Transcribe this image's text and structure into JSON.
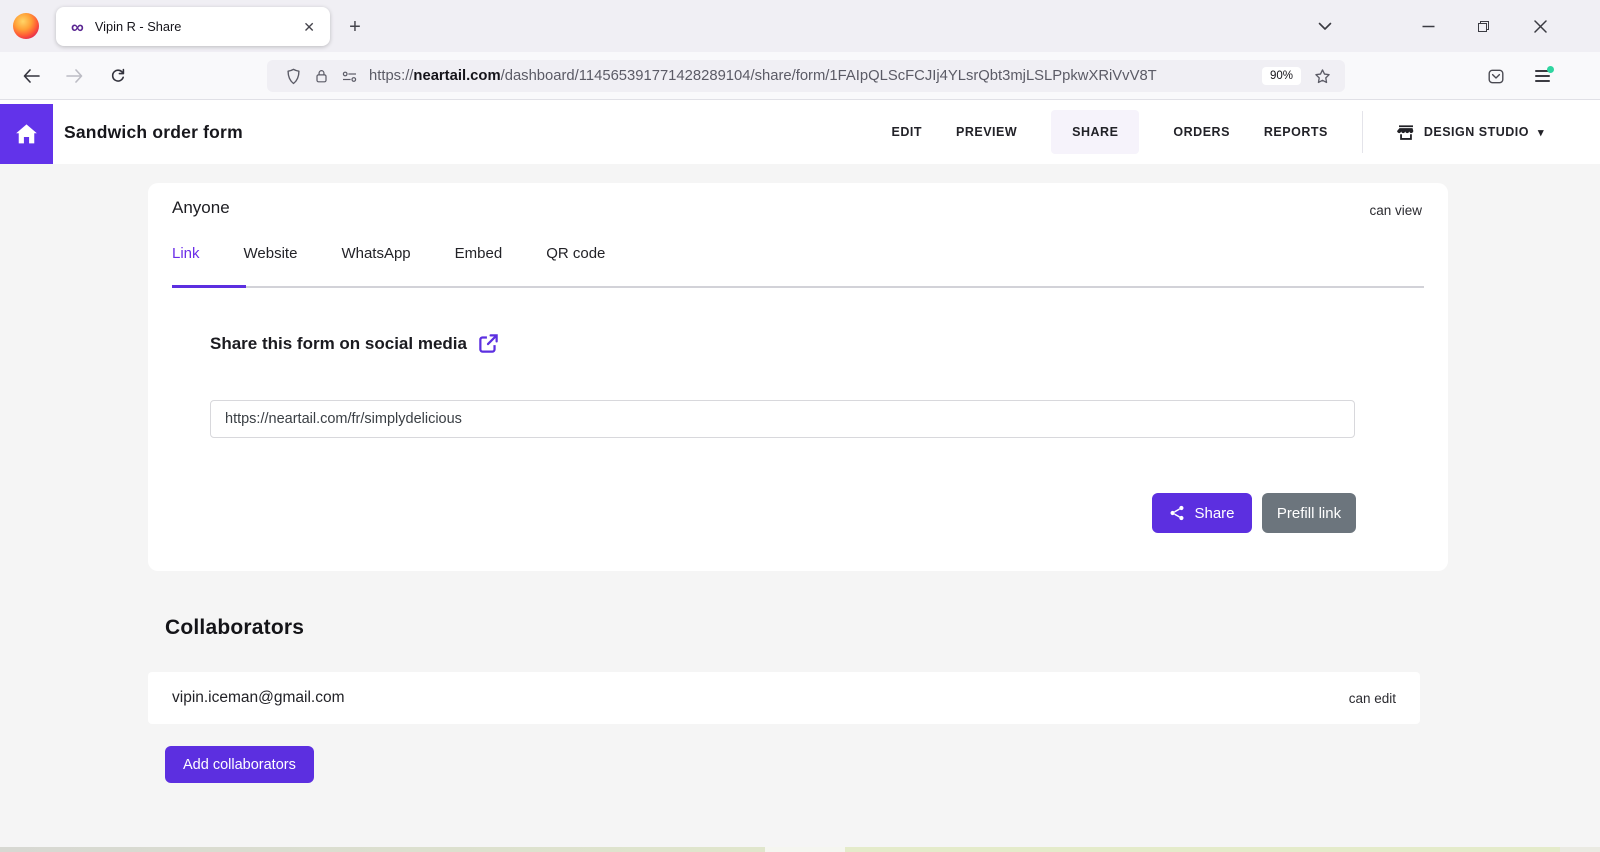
{
  "colors": {
    "accent_purple": "#5c2fe0",
    "home_square_purple": "#6233ea",
    "secondary_gray": "#6c757d",
    "active_nav_bg": "#f6f3fb",
    "page_bg": "#f5f5f5",
    "menu_dot_green": "#2fd5a0"
  },
  "icons": {
    "infinity_favicon": "∞",
    "tab_close": "✕",
    "new_tab_plus": "+",
    "design_studio_caret": "▾"
  },
  "browser": {
    "tab_title": "Vipin R - Share",
    "url_scheme": "https://",
    "url_domain": "neartail",
    "url_domain_suffix": ".com",
    "url_path": "/dashboard/114565391771428289104/share/form/1FAIpQLScFCJIj4YLsrQbt3mjLSLPpkwXRiVvV8T",
    "zoom_level": "90%"
  },
  "header": {
    "title": "Sandwich order form",
    "nav": [
      {
        "label": "EDIT",
        "active": false
      },
      {
        "label": "PREVIEW",
        "active": false
      },
      {
        "label": "SHARE",
        "active": true
      },
      {
        "label": "ORDERS",
        "active": false
      },
      {
        "label": "REPORTS",
        "active": false
      }
    ],
    "design_studio_label": "DESIGN STUDIO"
  },
  "share_card": {
    "audience_label": "Anyone",
    "permission_label": "can view",
    "tabs": [
      {
        "label": "Link",
        "active": true
      },
      {
        "label": "Website",
        "active": false
      },
      {
        "label": "WhatsApp",
        "active": false
      },
      {
        "label": "Embed",
        "active": false
      },
      {
        "label": "QR code",
        "active": false
      }
    ],
    "section_title": "Share this form on social media",
    "form_link": "https://neartail.com/fr/simplydelicious",
    "share_button_label": "Share",
    "prefill_button_label": "Prefill link"
  },
  "collaborators": {
    "title": "Collaborators",
    "rows": [
      {
        "email": "vipin.iceman@gmail.com",
        "permission": "can edit"
      }
    ],
    "add_button_label": "Add collaborators"
  }
}
